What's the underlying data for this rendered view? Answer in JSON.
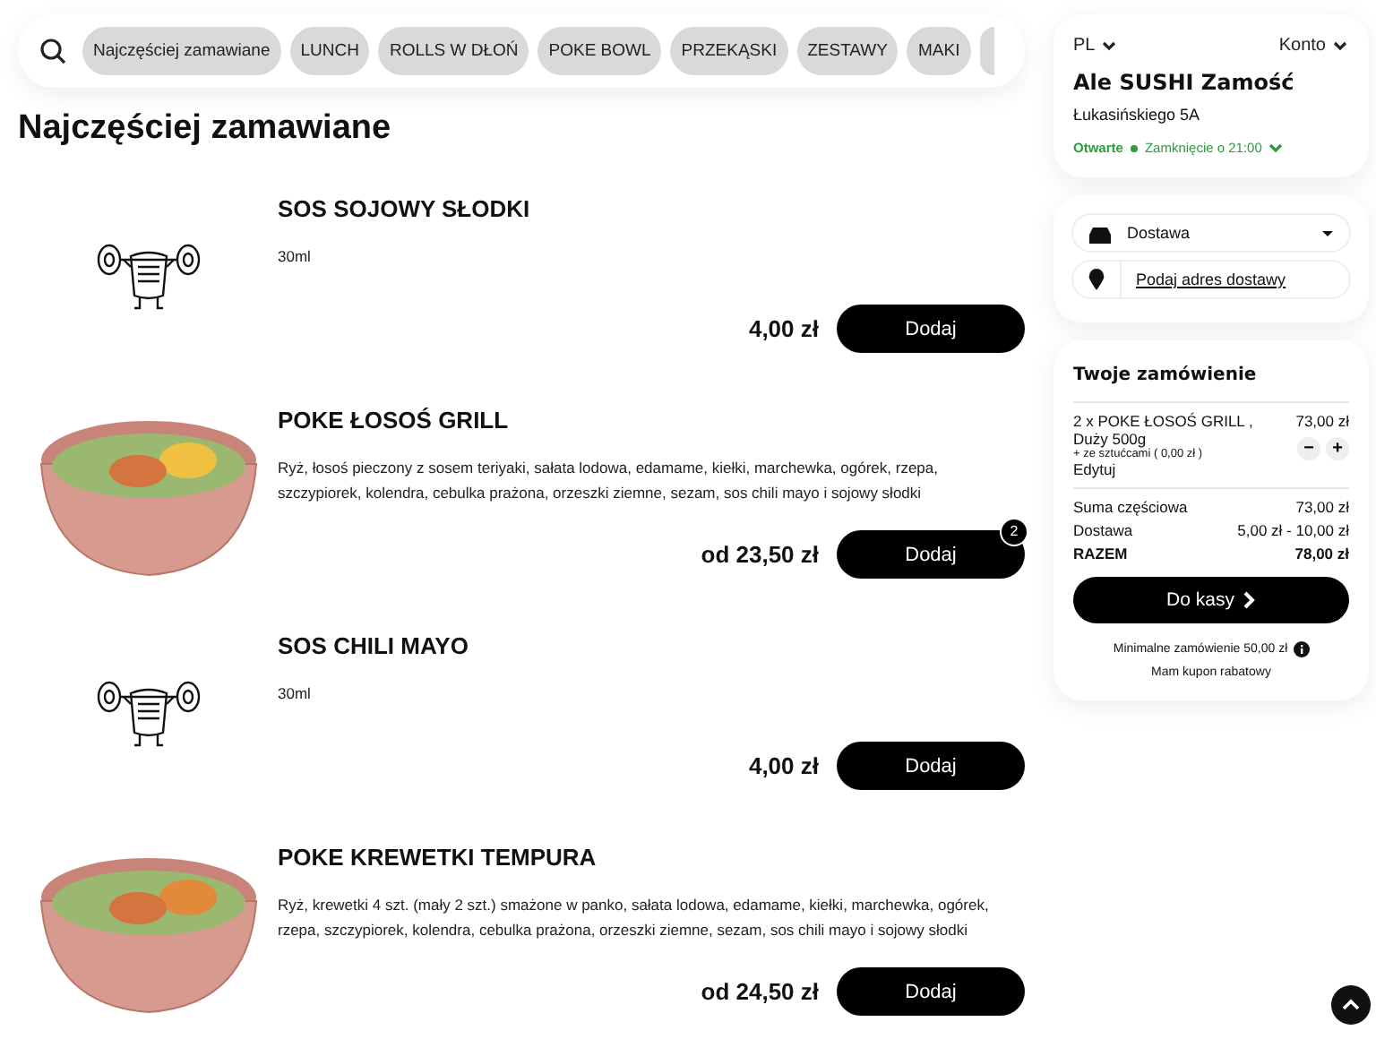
{
  "categories": [
    {
      "label": "Najczęściej zamawiane"
    },
    {
      "label": "LUNCH"
    },
    {
      "label": "ROLLS W DŁOŃ"
    },
    {
      "label": "POKE BOWL"
    },
    {
      "label": "PRZEKĄSKI"
    },
    {
      "label": "ZESTAWY"
    },
    {
      "label": "MAKI"
    }
  ],
  "section_title": "Najczęściej zamawiane",
  "products": [
    {
      "name": "SOS SOJOWY SŁODKI",
      "description": "30ml",
      "price": "4,00 zł",
      "button": "Dodaj",
      "kind": "drawing"
    },
    {
      "name": "POKE ŁOSOŚ GRILL",
      "description": "Ryż, łosoś pieczony z sosem teriyaki, sałata lodowa, edamame, kiełki, marchewka, ogórek, rzepa, szczypiorek, kolendra, cebulka prażona, orzeszki ziemne, sezam, sos chili mayo i sojowy słodki",
      "price": "od 23,50 zł",
      "button": "Dodaj",
      "kind": "photo",
      "badge": "2"
    },
    {
      "name": "SOS CHILI MAYO",
      "description": "30ml",
      "price": "4,00 zł",
      "button": "Dodaj",
      "kind": "drawing"
    },
    {
      "name": "POKE KREWETKI TEMPURA",
      "description": "Ryż, krewetki 4 szt. (mały 2 szt.) smażone w panko, sałata lodowa, edamame, kiełki, marchewka, ogórek, rzepa, szczypiorek, kolendra, cebulka prażona, orzeszki ziemne, sezam, sos chili mayo i sojowy słodki",
      "price": "od 24,50 zł",
      "button": "Dodaj",
      "kind": "photo"
    }
  ],
  "restaurant": {
    "language": "PL",
    "account": "Konto",
    "name": "Ale SUSHI Zamość",
    "address": "Łukasińskiego 5A",
    "status": "Otwarte",
    "hours": "Zamknięcie o 21:00"
  },
  "delivery": {
    "mode": "Dostawa",
    "address_link": "Podaj adres dostawy"
  },
  "cart": {
    "title": "Twoje zamówienie",
    "items": [
      {
        "name": "2 x POKE ŁOSOŚ GRILL , Duży 500g",
        "price": "73,00 zł",
        "option": "+ ze sztućcami ( 0,00 zł )",
        "edit": "Edytuj",
        "minus": "−",
        "plus": "+"
      }
    ],
    "totals": [
      {
        "label": "Suma częściowa",
        "value": "73,00 zł",
        "kind": "normal"
      },
      {
        "label": "Dostawa",
        "value": "5,00 zł - 10,00 zł",
        "kind": "normal"
      },
      {
        "label": "RAZEM",
        "value": "78,00 zł",
        "kind": "total"
      }
    ],
    "checkout": "Do kasy",
    "minimum": "Minimalne zamówienie 50,00 zł",
    "coupon": "Mam kupon rabatowy"
  }
}
